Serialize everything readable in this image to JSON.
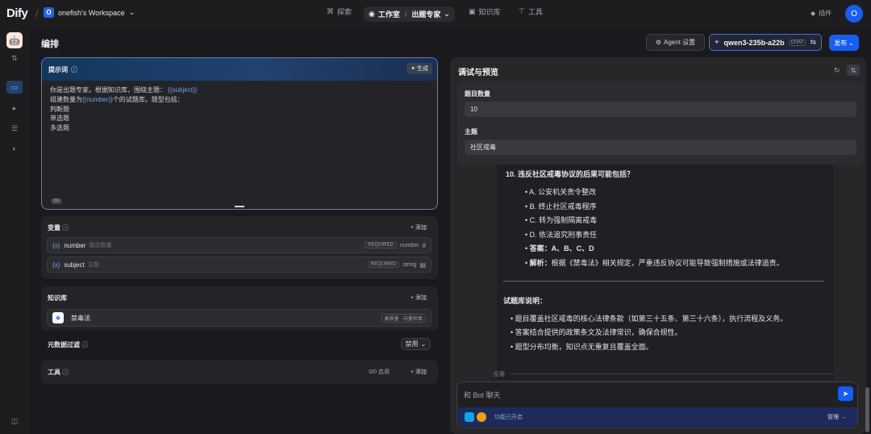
{
  "brand": "Dify",
  "workspace": {
    "avatar": "O",
    "name": "onefish's Workspace"
  },
  "nav": [
    "探索",
    "工作室",
    "出题专家",
    "知识库",
    "工具"
  ],
  "plugins": "插件",
  "user_initial": "O",
  "editor": {
    "title": "编排",
    "agent_settings": "Agent 设置",
    "model": "qwen3-235b-a22b",
    "model_mode": "CHAT",
    "publish": "发布"
  },
  "prompt": {
    "label": "提示词",
    "generate": "生成",
    "line1_a": "你是出题专家。根据知识库，围绕主题：",
    "subject_var": "{{subject}}",
    "line2_a": "组建数量为",
    "number_var": "{{number}}",
    "line2_b": "个的试题库。题型包括：",
    "types": [
      "判断题",
      "单选题",
      "多选题"
    ],
    "count": "69"
  },
  "variables": {
    "label": "变量",
    "add": "+ 添加",
    "items": [
      {
        "name": "number",
        "desc": "题目数量",
        "required": "REQUIRED",
        "type": "number"
      },
      {
        "name": "subject",
        "desc": "主题",
        "required": "REQUIRED",
        "type": "string"
      }
    ]
  },
  "knowledge": {
    "label": "知识库",
    "add": "+ 添加",
    "item": "禁毒法",
    "tag": "高质量 · 向量检索"
  },
  "metadata": {
    "label": "元数据过滤",
    "value": "禁用"
  },
  "tools": {
    "label": "工具",
    "status": "0/0 启用",
    "add": "+ 添加"
  },
  "debug": {
    "title": "调试与预览",
    "q_count_label": "题目数量",
    "q_count": "10",
    "subject_label": "主题",
    "subject": "社区戒毒"
  },
  "chat": {
    "question": "10. 违反社区戒毒协议的后果可能包括？",
    "options": [
      "A. 公安机关责令整改",
      "B. 终止社区戒毒程序",
      "C. 转为强制隔离戒毒",
      "D. 依法追究刑事责任"
    ],
    "answer_label": "答案：",
    "answer": "A、B、C、D",
    "analysis_label": "解析：",
    "analysis": "根据《禁毒法》相关规定，严重违反协议可能导致强制措施或法律追责。",
    "desc_title": "试题库说明：",
    "desc": [
      "题目覆盖社区戒毒的核心法律条款（如第三十五条、第三十六条），执行流程及义务。",
      "答案结合提供的政策条文及法律常识，确保合规性。",
      "题型分布均衡，知识点无重复且覆盖全面。"
    ],
    "cite": "引用",
    "placeholder": "和 Bot 聊天",
    "feature": "功能已开启",
    "manage": "管理"
  }
}
